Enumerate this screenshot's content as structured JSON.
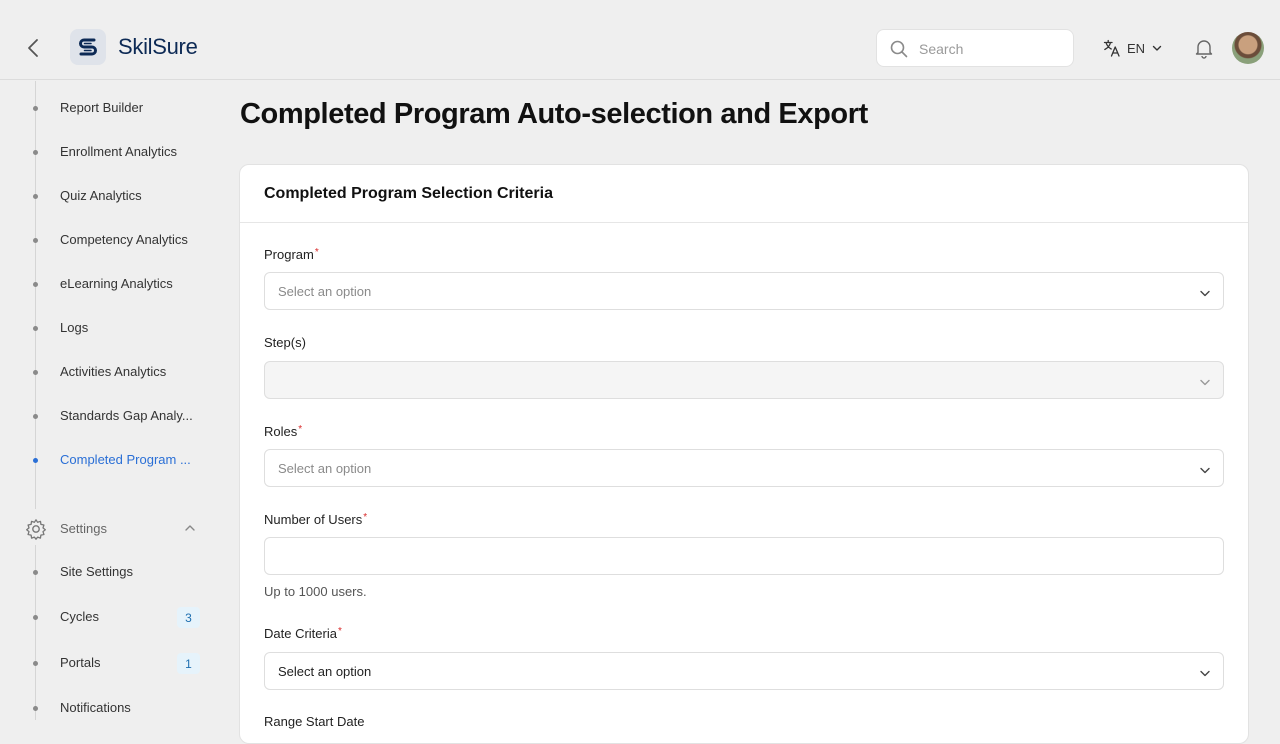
{
  "header": {
    "brand": "SkilSure",
    "search_placeholder": "Search",
    "language": "EN"
  },
  "sidebar": {
    "items": [
      {
        "label": "Report Builder",
        "active": false
      },
      {
        "label": "Enrollment Analytics",
        "active": false
      },
      {
        "label": "Quiz Analytics",
        "active": false
      },
      {
        "label": "Competency Analytics",
        "active": false
      },
      {
        "label": "eLearning Analytics",
        "active": false
      },
      {
        "label": "Logs",
        "active": false
      },
      {
        "label": "Activities Analytics",
        "active": false
      },
      {
        "label": "Standards Gap Analy...",
        "active": false
      },
      {
        "label": "Completed Program ...",
        "active": true
      }
    ],
    "settings": {
      "label": "Settings",
      "items": [
        {
          "label": "Site Settings"
        },
        {
          "label": "Cycles",
          "badge": "3"
        },
        {
          "label": "Portals",
          "badge": "1"
        },
        {
          "label": "Notifications"
        }
      ]
    }
  },
  "main": {
    "title": "Completed Program Auto-selection and Export",
    "card_title": "Completed Program Selection Criteria",
    "fields": {
      "program": {
        "label": "Program",
        "placeholder": "Select an option"
      },
      "steps": {
        "label": "Step(s)"
      },
      "roles": {
        "label": "Roles",
        "placeholder": "Select an option"
      },
      "num_users": {
        "label": "Number of Users",
        "helper": "Up to 1000 users."
      },
      "date_criteria": {
        "label": "Date Criteria",
        "value": "Select an option"
      },
      "next_label": "Range Start Date"
    }
  },
  "colors": {
    "accent": "#2a6fd6",
    "required": "#d92a2a",
    "brand": "#0d2a55"
  }
}
